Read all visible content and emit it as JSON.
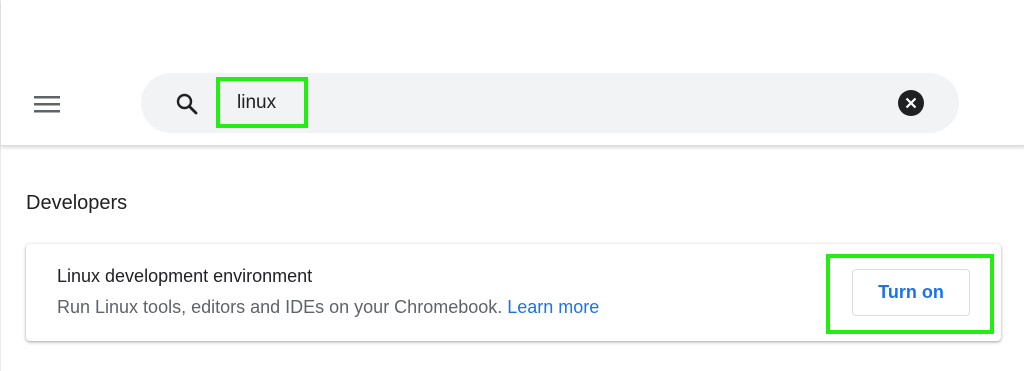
{
  "window_controls": {
    "minimize_icon": "minimize-icon",
    "maximize_icon": "maximize-icon",
    "close_icon": "close-icon"
  },
  "header": {
    "menu_icon": "hamburger-menu-icon",
    "search": {
      "icon": "search-icon",
      "value": "linux",
      "clear_icon": "clear-search-icon"
    }
  },
  "section": {
    "title": "Developers",
    "card": {
      "title": "Linux development environment",
      "description": "Run Linux tools, editors and IDEs on your Chromebook.",
      "link_label": "Learn more",
      "button_label": "Turn on"
    }
  },
  "colors": {
    "accent": "#1a73e8",
    "highlight": "#22ee11",
    "search_bg": "#f1f3f4",
    "text_primary": "#202124",
    "text_secondary": "#5f6368"
  }
}
